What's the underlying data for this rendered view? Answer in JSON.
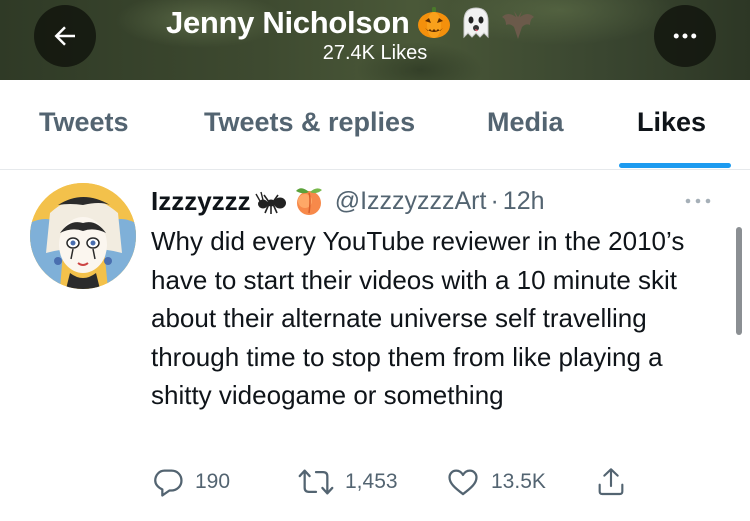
{
  "header": {
    "title": "Jenny Nicholson",
    "title_emojis": [
      "jack-o-lantern",
      "ghost",
      "bat"
    ],
    "subtitle": "27.4K Likes",
    "back_icon": "arrow-left-icon",
    "more_icon": "more-horizontal-icon"
  },
  "tabs": [
    {
      "label": "Tweets",
      "active": false
    },
    {
      "label": "Tweets & replies",
      "active": false
    },
    {
      "label": "Media",
      "active": false
    },
    {
      "label": "Likes",
      "active": true
    }
  ],
  "tweet": {
    "author_name": "Izzzyzzz",
    "name_emojis": [
      "ant",
      "peach"
    ],
    "handle": "@IzzzyzzzArt",
    "separator": "·",
    "time": "12h",
    "text": "Why did every YouTube reviewer in the 2010’s have to start their videos with a 10 minute skit about their alternate universe self travelling through time to stop them from like playing a shitty videogame or something",
    "actions": {
      "replies": "190",
      "retweets": "1,453",
      "likes": "13.5K"
    }
  },
  "colors": {
    "accent": "#1d9bf0",
    "secondary_text": "#536471",
    "primary_text": "#0f1419"
  }
}
